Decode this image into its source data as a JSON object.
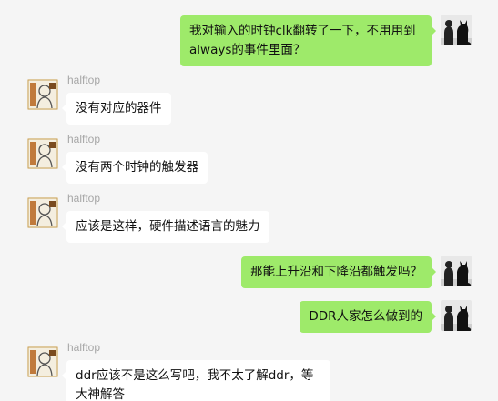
{
  "contact": {
    "name": "halftop"
  },
  "colors": {
    "background": "#f5f5f5",
    "outgoing_bubble": "#9eea6a",
    "incoming_bubble": "#ffffff",
    "sender_name": "#a7a7a7"
  },
  "messages": [
    {
      "direction": "out",
      "text": "我对输入的时钟clk翻转了一下，不用用到always的事件里面？"
    },
    {
      "direction": "in",
      "sender": "halftop",
      "text": "没有对应的器件"
    },
    {
      "direction": "in",
      "sender": "halftop",
      "text": "没有两个时钟的触发器"
    },
    {
      "direction": "in",
      "sender": "halftop",
      "text": "应该是这样，硬件描述语言的魅力"
    },
    {
      "direction": "out",
      "text": "那能上升沿和下降沿都触发吗？"
    },
    {
      "direction": "out",
      "text": "DDR人家怎么做到的"
    },
    {
      "direction": "in",
      "sender": "halftop",
      "text": "ddr应该不是这么写吧，我不太了解ddr，等大神解答"
    }
  ],
  "icons": {
    "self_avatar": "cat-silhouette-avatar-icon",
    "contact_avatar": "sketch-avatar-icon"
  }
}
